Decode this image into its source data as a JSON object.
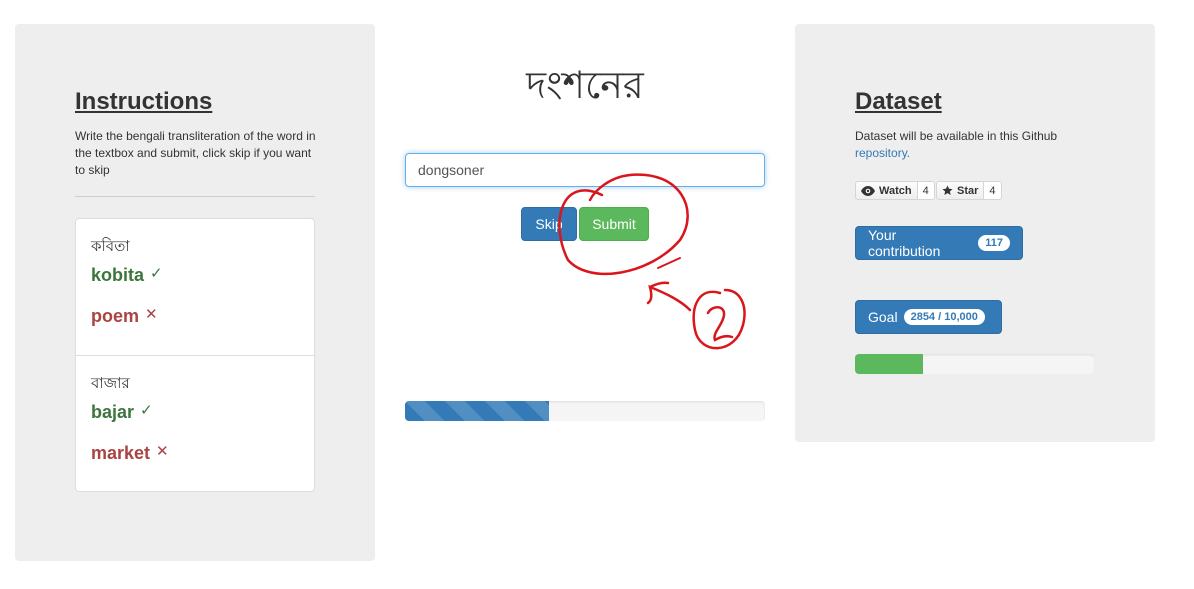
{
  "instructions": {
    "title": "Instructions",
    "text": "Write the bengali transliteration of the word in the textbox and submit, click skip if you want to skip"
  },
  "examples": [
    {
      "bengali": "কবিতা",
      "correct": "kobita",
      "wrong": "poem"
    },
    {
      "bengali": "বাজার",
      "correct": "bajar",
      "wrong": "market"
    }
  ],
  "marks": {
    "correct": "✓",
    "wrong": "✕"
  },
  "word": "দংশনের",
  "input": {
    "value": "dongsoner"
  },
  "buttons": {
    "skip": "Skip",
    "submit": "Submit"
  },
  "progress": {
    "main_fraction": 0.4,
    "goal_fraction": 0.285
  },
  "dataset": {
    "title": "Dataset",
    "text": "Dataset will be available in this Github ",
    "link": "repository."
  },
  "github": {
    "watch_label": "Watch",
    "watch_count": "4",
    "star_label": "Star",
    "star_count": "4"
  },
  "contribution": {
    "label": "Your contribution",
    "count": "117"
  },
  "goal": {
    "label": "Goal",
    "value": "2854 / 10,000"
  },
  "colors": {
    "primary": "#337ab7",
    "success": "#5cb85c",
    "correct_text": "#3c763d",
    "wrong_text": "#a94442",
    "annotation": "#d9161c"
  }
}
